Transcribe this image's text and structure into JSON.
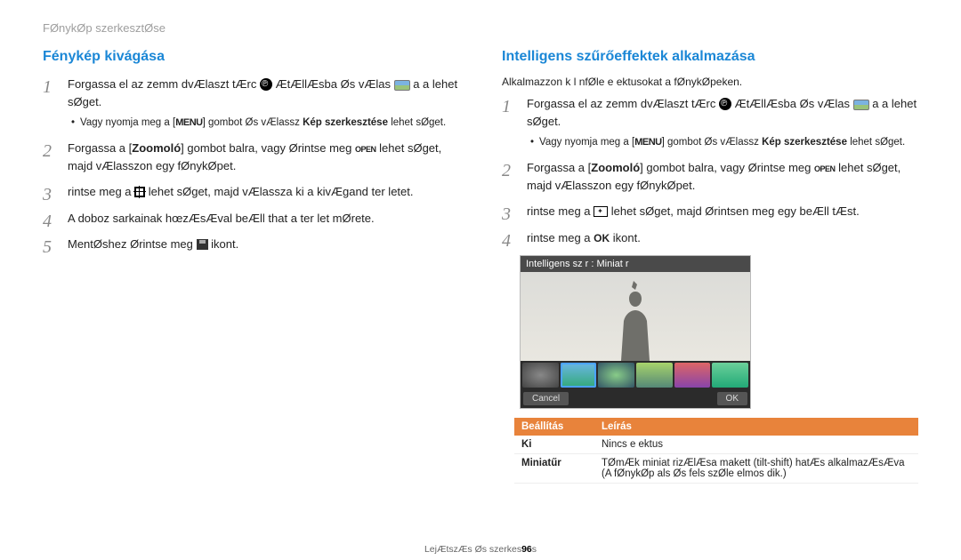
{
  "breadcrumb": "FØnykØp szerkesztØse",
  "left": {
    "title": "Fénykép kivágása",
    "steps": [
      {
        "pre": "Forgassa el az  zemm dvÆlaszt  tÆrc",
        "mid": "ÆtÆllÆsba Øs vÆlas",
        "post": "a a lehet sØget.",
        "sub_pre": "Vagy nyomja meg a",
        "sub_menu": "MENU",
        "sub_mid": "gombot Øs vÆlassz",
        "sub_bold": "Kép szerkesztése",
        "sub_post": "lehet sØget."
      },
      {
        "pre": "Forgassa a",
        "bold1": "Zoomoló",
        "mid": "gombot balra, vagy Ørintse meg",
        "open": "OPEN",
        "post": "lehet sØget, majd vÆlasszon egy fØnykØpet."
      },
      {
        "pre": "rintse meg a",
        "post": "lehet sØget, majd vÆlassza ki a kivÆgand ter letet."
      },
      {
        "text": "A doboz sarkainak hœzÆsÆval beÆll that  a ter let mØrete."
      },
      {
        "pre": "MentØshez Ørintse meg",
        "post": "ikont."
      }
    ]
  },
  "right": {
    "title": "Intelligens szűrőeffektek alkalmazása",
    "intro": "Alkalmazzon k l nfØle e ektusokat a fØnykØpeken.",
    "steps": [
      {
        "pre": "Forgassa el az  zemm dvÆlaszt  tÆrc",
        "mid": "ÆtÆllÆsba Øs vÆlas",
        "post": "a a lehet sØget.",
        "sub_pre": "Vagy nyomja meg a",
        "sub_menu": "MENU",
        "sub_mid": "gombot Øs vÆlassz",
        "sub_bold": "Kép szerkesztése",
        "sub_post": "lehet sØget."
      },
      {
        "pre": "Forgassa a",
        "bold1": "Zoomoló",
        "mid": "gombot balra, vagy Ørintse meg",
        "open": "OPEN",
        "post": "lehet sØget, majd vÆlasszon egy fØnykØpet."
      },
      {
        "pre": "rintse meg a",
        "post": "lehet sØget, majd Ørintsen meg egy beÆll tÆst."
      },
      {
        "pre": "rintse meg a",
        "ok": "OK",
        "post": "ikont."
      }
    ],
    "preview_title": "Intelligens sz r : Miniat r",
    "preview_cancel": "Cancel",
    "preview_ok": "OK",
    "table": {
      "h1": "Beállítás",
      "h2": "Leírás",
      "rows": [
        {
          "k": "Ki",
          "v": "Nincs e ektus"
        },
        {
          "k": "Miniatűr",
          "v": "TØmÆk miniat rizÆlÆsa makett (tilt-shift) hatÆs alkalmazÆsÆva (A fØnykØp als Øs fels  szØle elmos dik.)"
        }
      ]
    }
  },
  "footer": {
    "left": "LejÆtszÆs Øs szerkes",
    "page": "96",
    "right": "s"
  }
}
